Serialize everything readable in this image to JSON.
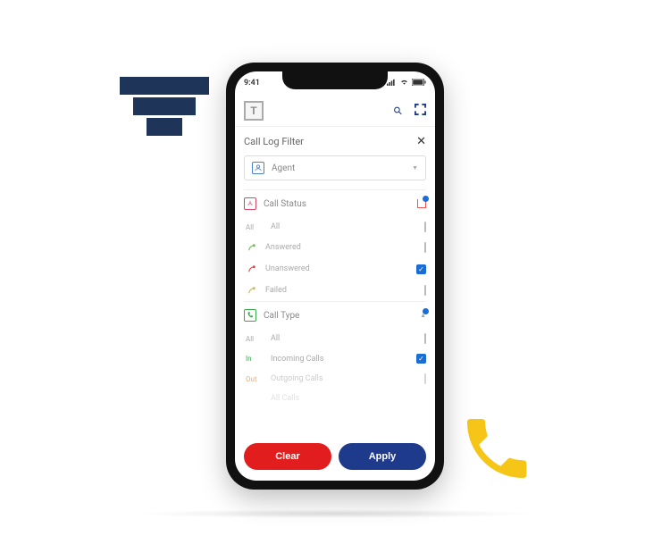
{
  "status_bar": {
    "time": "9:41",
    "signal_icon": "signal",
    "wifi_icon": "wifi",
    "battery_icon": "battery"
  },
  "app_bar": {
    "logo_letter": "T",
    "search_icon": "search-icon",
    "grid_icon": "grid-icon"
  },
  "panel": {
    "title": "Call Log Filter",
    "close_icon": "close-icon"
  },
  "agent": {
    "label": "Agent",
    "value": "",
    "icon": "agent-icon"
  },
  "status_group": {
    "label": "Call Status",
    "icon": "status-icon",
    "badge": 1,
    "options": [
      {
        "tag": "All",
        "label": "All",
        "checked": false
      },
      {
        "tag": "",
        "label": "Answered",
        "checked": false,
        "icon_color": "#6cc04a"
      },
      {
        "tag": "",
        "label": "Unanswered",
        "checked": true,
        "icon_color": "#d14a4a"
      },
      {
        "tag": "",
        "label": "Failed",
        "checked": false,
        "icon_color": "#c9b84a"
      }
    ]
  },
  "type_group": {
    "label": "Call Type",
    "icon": "type-icon",
    "badge": 1,
    "options": [
      {
        "tag": "All",
        "label": "All",
        "checked": false
      },
      {
        "tag": "In",
        "label": "Incoming Calls",
        "checked": true,
        "tag_color": "#3aa84a"
      },
      {
        "tag": "Out",
        "label": "Outgoing Calls",
        "checked": false,
        "tag_color": "#d17a2a"
      }
    ],
    "hidden_behind": {
      "label": "All Calls"
    }
  },
  "actions": {
    "clear": "Clear",
    "apply": "Apply"
  },
  "colors": {
    "primary": "#1e3a8a",
    "danger": "#e21d1d",
    "check": "#1a6dd4",
    "accent": "#f5c518",
    "funnel": "#1e3459"
  }
}
